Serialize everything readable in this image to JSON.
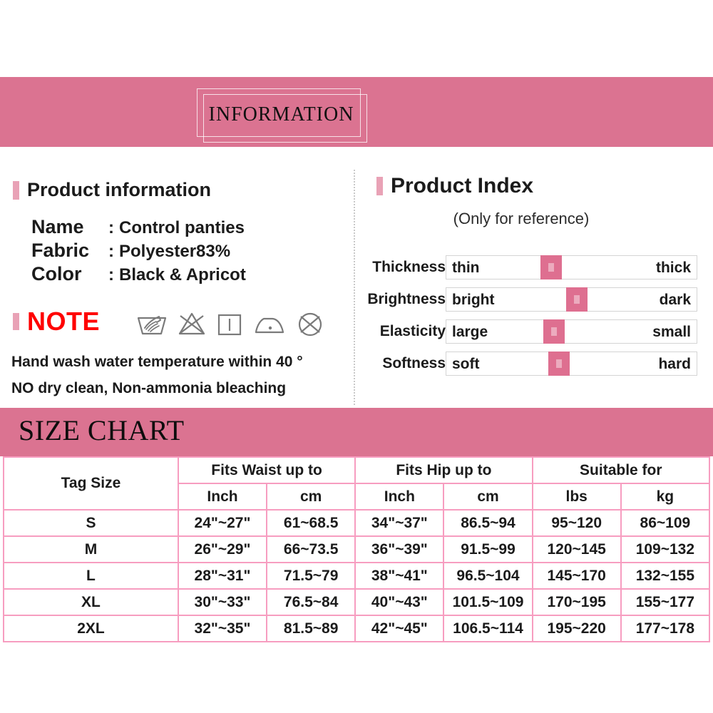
{
  "banner": {
    "title": "INFORMATION"
  },
  "product_information": {
    "heading": "Product information",
    "specs": [
      {
        "key": "Name",
        "colon": ":",
        "value": "Control panties"
      },
      {
        "key": "Fabric",
        "colon": ":",
        "value": "Polyester83%"
      },
      {
        "key": "Color",
        "colon": ":",
        "value": "Black & Apricot"
      }
    ]
  },
  "note": {
    "heading": "NOTE",
    "icons": [
      "hand-wash-icon",
      "no-bleach-icon",
      "drip-dry-icon",
      "iron-low-heat-icon",
      "no-dry-clean-icon"
    ],
    "lines": [
      "Hand wash water temperature within 40 °",
      "NO dry clean, Non-ammonia bleaching"
    ]
  },
  "product_index": {
    "heading": "Product Index",
    "subheading": "(Only for reference)",
    "thumb_color": "#DE6F90",
    "rows": [
      {
        "label": "Thickness",
        "min": "thin",
        "max": "thick",
        "position": 42
      },
      {
        "label": "Brightness",
        "min": "bright",
        "max": "dark",
        "position": 52
      },
      {
        "label": "Elasticity",
        "min": "large",
        "max": "small",
        "position": 43
      },
      {
        "label": "Softness",
        "min": "soft",
        "max": "hard",
        "position": 45
      }
    ]
  },
  "size_chart": {
    "title": "SIZE CHART",
    "group_headers": [
      {
        "label": "Tag Size",
        "span": 1
      },
      {
        "label": "Fits Waist up to",
        "span": 2
      },
      {
        "label": "Fits Hip up to",
        "span": 2
      },
      {
        "label": "Suitable for",
        "span": 2
      }
    ],
    "sub_headers": [
      "Inch",
      "cm",
      "Inch",
      "cm",
      "lbs",
      "kg"
    ],
    "rows": [
      {
        "tag": "S",
        "waist_inch": "24\"~27\"",
        "waist_cm": "61~68.5",
        "hip_inch": "34\"~37\"",
        "hip_cm": "86.5~94",
        "lbs": "95~120",
        "kg": "86~109"
      },
      {
        "tag": "M",
        "waist_inch": "26\"~29\"",
        "waist_cm": "66~73.5",
        "hip_inch": "36\"~39\"",
        "hip_cm": "91.5~99",
        "lbs": "120~145",
        "kg": "109~132"
      },
      {
        "tag": "L",
        "waist_inch": "28\"~31\"",
        "waist_cm": "71.5~79",
        "hip_inch": "38\"~41\"",
        "hip_cm": "96.5~104",
        "lbs": "145~170",
        "kg": "132~155"
      },
      {
        "tag": "XL",
        "waist_inch": "30\"~33\"",
        "waist_cm": "76.5~84",
        "hip_inch": "40\"~43\"",
        "hip_cm": "101.5~109",
        "lbs": "170~195",
        "kg": "155~177"
      },
      {
        "tag": "2XL",
        "waist_inch": "32\"~35\"",
        "waist_cm": "81.5~89",
        "hip_inch": "42\"~45\"",
        "hip_cm": "106.5~114",
        "lbs": "195~220",
        "kg": "177~178"
      }
    ]
  },
  "colors": {
    "banner_pink": "#DB7391",
    "grid_pink": "#F79DC0",
    "marker_pink": "#E9A2B6",
    "note_red": "#FF0000",
    "icon_gray": "#7a7a7a"
  }
}
